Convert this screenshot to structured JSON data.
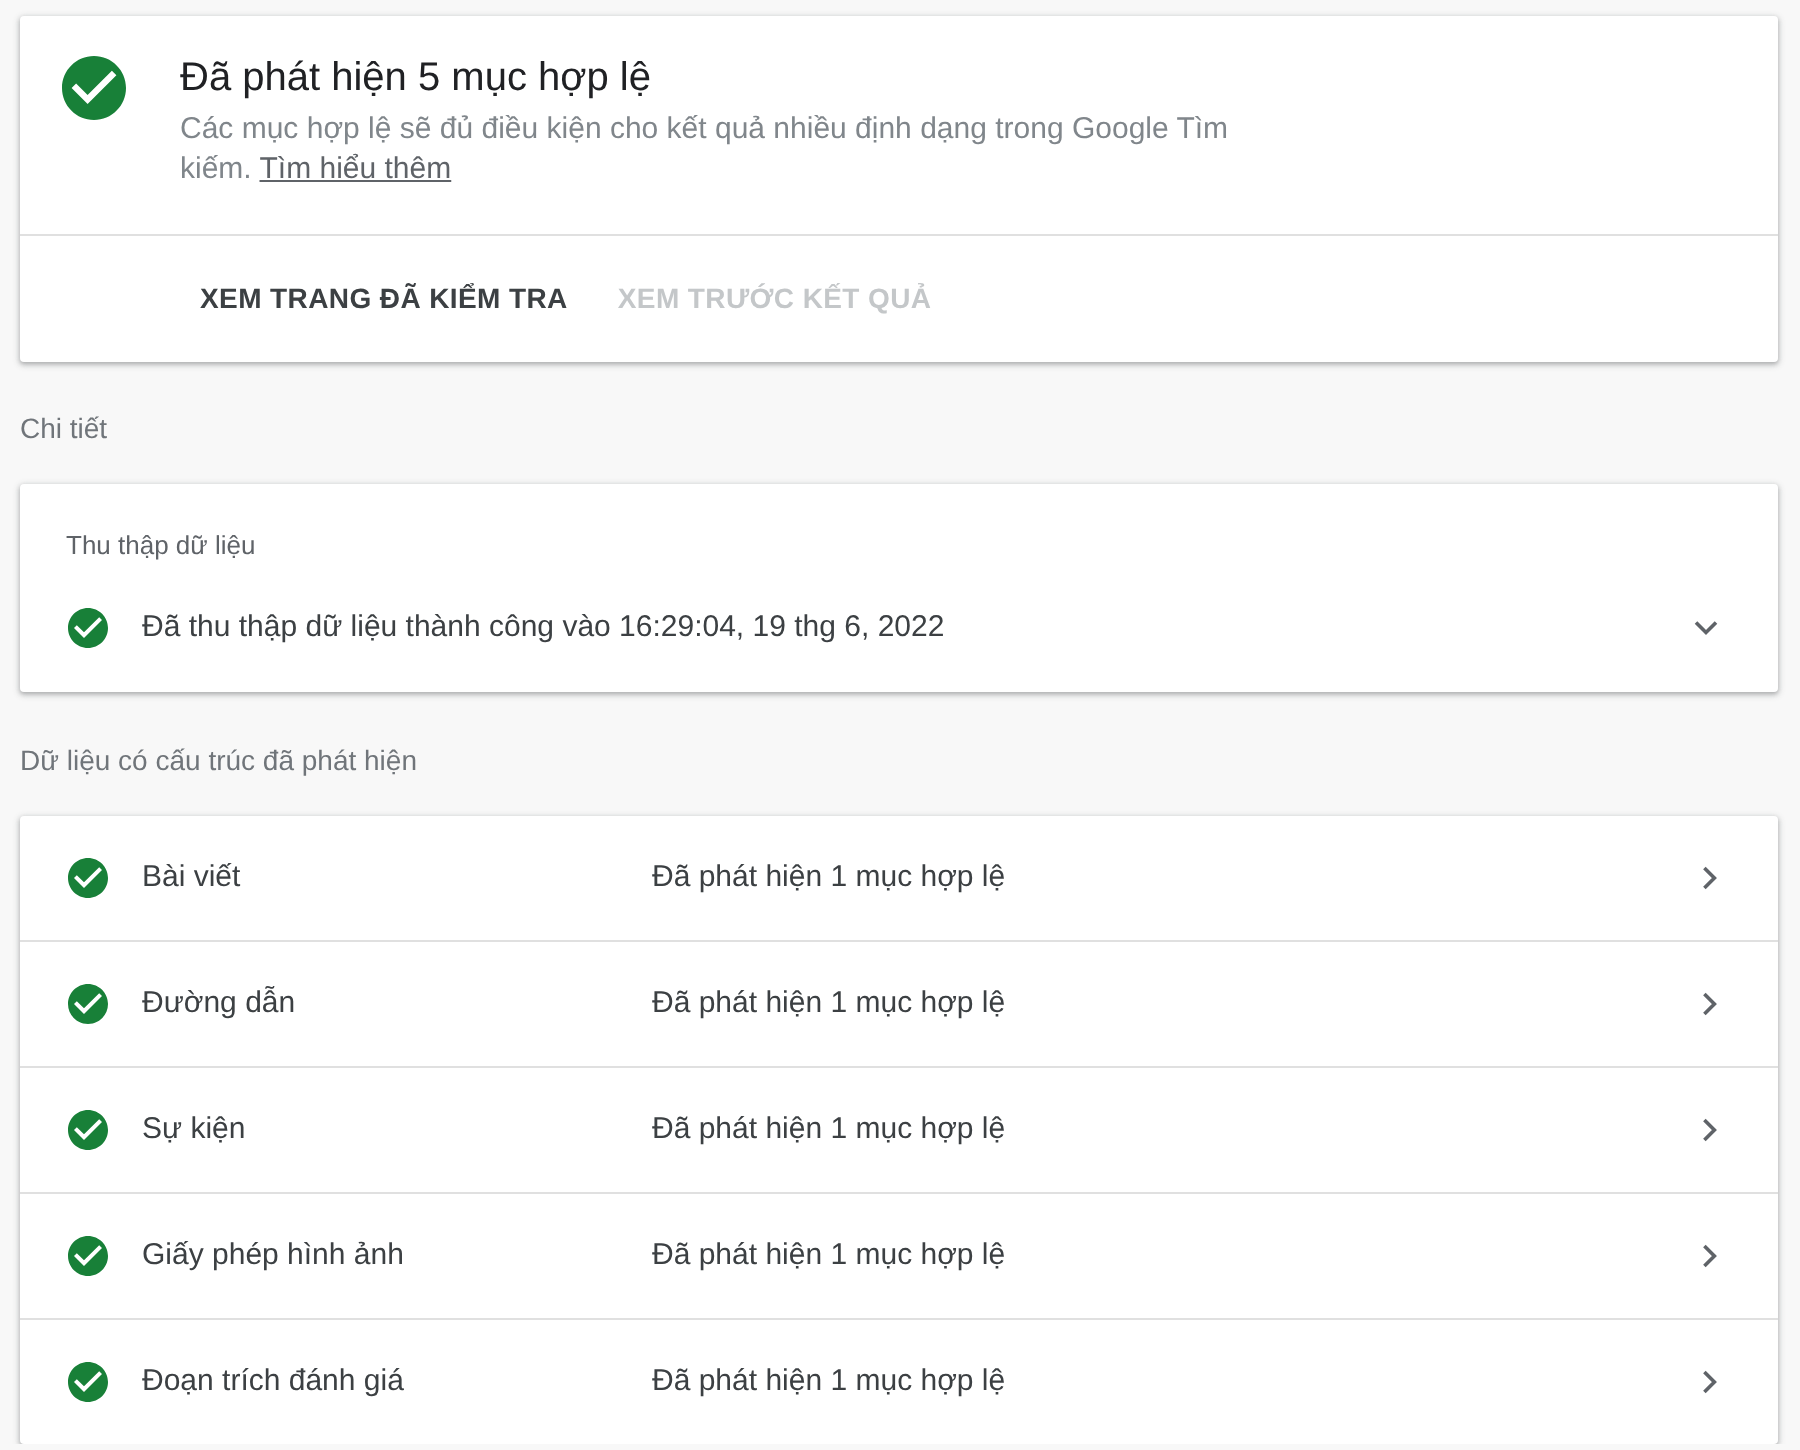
{
  "summary": {
    "valid": true,
    "title": "Đã phát hiện 5 mục hợp lệ",
    "description": "Các mục hợp lệ sẽ đủ điều kiện cho kết quả nhiều định dạng trong Google Tìm kiếm.",
    "link": "Tìm hiểu thêm",
    "actions": [
      {
        "label": "XEM TRANG ĐÃ KIỂM TRA",
        "disabled": false
      },
      {
        "label": "XEM TRƯỚC KẾT QUẢ",
        "disabled": true
      }
    ]
  },
  "details": {
    "heading": "Chi tiết",
    "card": {
      "title": "Thu thập dữ liệu",
      "valid": true,
      "text": "Đã thu thập dữ liệu thành công vào 16:29:04, 19 thg 6, 2022",
      "expanded": false
    }
  },
  "structured_data": {
    "heading": "Dữ liệu có cấu trúc đã phát hiện",
    "items": [
      {
        "name": "Bài viết",
        "valid": true,
        "result": "Đã phát hiện 1 mục hợp lệ"
      },
      {
        "name": "Đường dẫn",
        "valid": true,
        "result": "Đã phát hiện 1 mục hợp lệ"
      },
      {
        "name": "Sự kiện",
        "valid": true,
        "result": "Đã phát hiện 1 mục hợp lệ"
      },
      {
        "name": "Giấy phép hình ảnh",
        "valid": true,
        "result": "Đã phát hiện 1 mục hợp lệ"
      },
      {
        "name": "Đoạn trích đánh giá",
        "valid": true,
        "result": "Đã phát hiện 1 mục hợp lệ"
      }
    ]
  }
}
